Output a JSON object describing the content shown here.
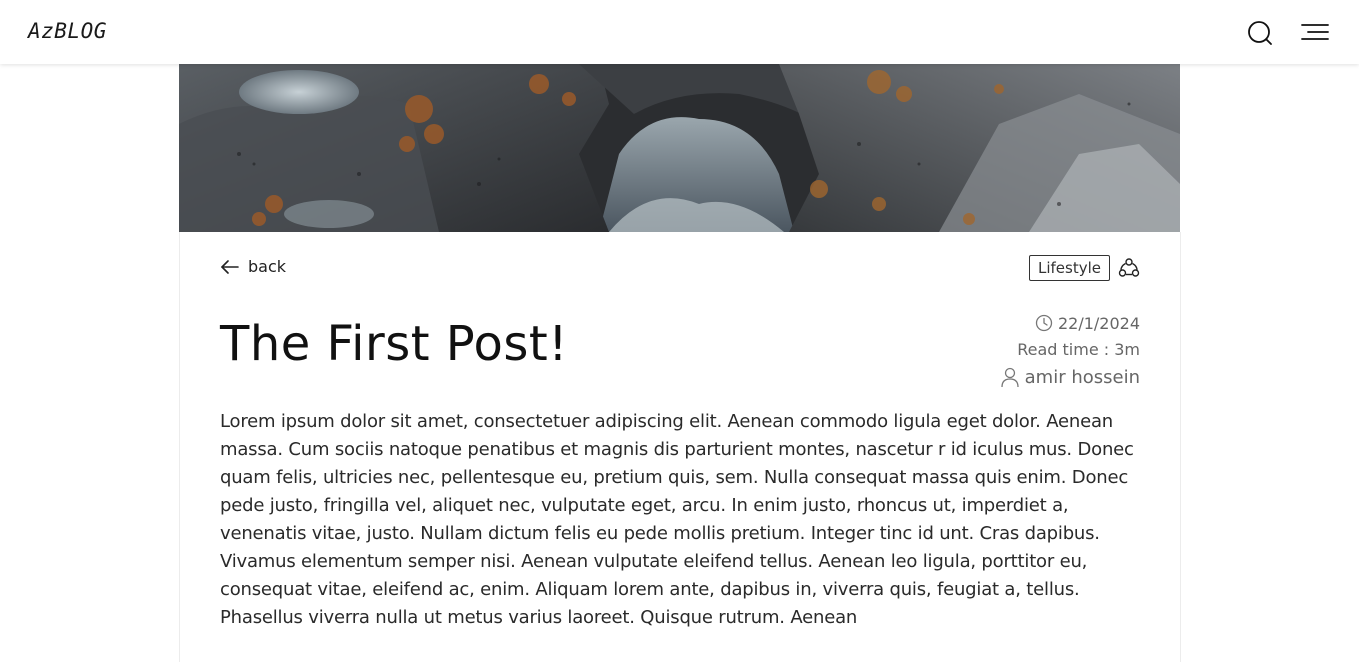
{
  "header": {
    "logo": "AzBLOG",
    "search_icon": "search-icon",
    "menu_icon": "menu-icon"
  },
  "post": {
    "back_label": "back",
    "category": "Lifestyle",
    "title": "The First Post!",
    "date": "22/1/2024",
    "read_time": "Read time : 3m",
    "author": "amir hossein",
    "body": "Lorem ipsum dolor sit amet, consectetuer adipiscing elit. Aenean commodo ligula eget dolor. Aenean massa. Cum sociis natoque penatibus et magnis dis parturient montes, nascetur r id iculus mus. Donec quam felis, ultricies nec, pellentesque eu, pretium quis, sem. Nulla consequat massa quis enim. Donec pede justo, fringilla vel, aliquet nec, vulputate eget, arcu. In enim justo, rhoncus ut, imperdiet a, venenatis vitae, justo. Nullam dictum felis eu pede mollis pretium. Integer tinc id unt. Cras dapibus. Vivamus elementum semper nisi. Aenean vulputate eleifend tellus. Aenean leo ligula, porttitor eu, consequat vitae, eleifend ac, enim. Aliquam lorem ante, dapibus in, viverra quis, feugiat a, tellus. Phasellus viverra nulla ut metus varius laoreet. Quisque rutrum. Aenean"
  },
  "colors": {
    "text": "#1a1a1a",
    "muted": "#666666",
    "border": "#ececec"
  }
}
